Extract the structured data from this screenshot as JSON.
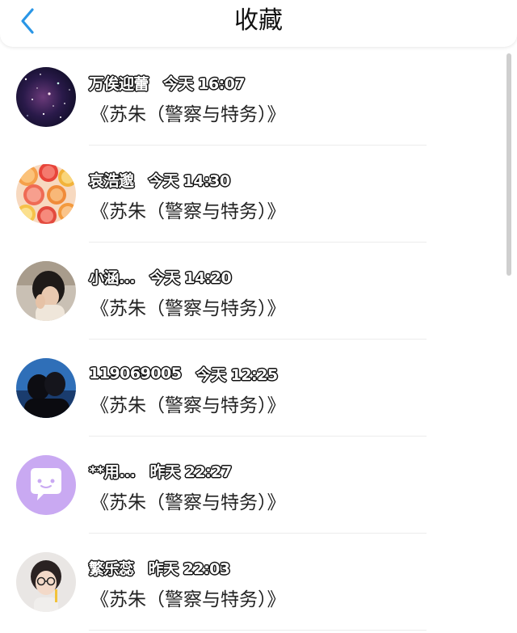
{
  "header": {
    "title": "收藏",
    "back_icon": "chevron-left-icon",
    "accent_color": "#2a96e6"
  },
  "items": [
    {
      "name": "万俟迎蕾",
      "time": "今天 16:07",
      "subtitle": "《苏朱（警察与特务）》",
      "avatar": "starry-night-avatar"
    },
    {
      "name": "哀浩邈",
      "time": "今天 14:30",
      "subtitle": "《苏朱（警察与特务）》",
      "avatar": "citrus-slices-avatar"
    },
    {
      "name": "小涵...",
      "time": "今天 14:20",
      "subtitle": "《苏朱（警察与特务）》",
      "avatar": "girl-photo-avatar"
    },
    {
      "name": "119069005",
      "time": "今天 12:25",
      "subtitle": "《苏朱（警察与特务）》",
      "avatar": "couple-silhouette-avatar"
    },
    {
      "name": "**用...",
      "time": "昨天 22:27",
      "subtitle": "《苏朱（警察与特务）》",
      "avatar": "chat-bubble-avatar"
    },
    {
      "name": "繁乐蕊",
      "time": "昨天 22:03",
      "subtitle": "《苏朱（警察与特务）》",
      "avatar": "glasses-girl-avatar"
    }
  ]
}
